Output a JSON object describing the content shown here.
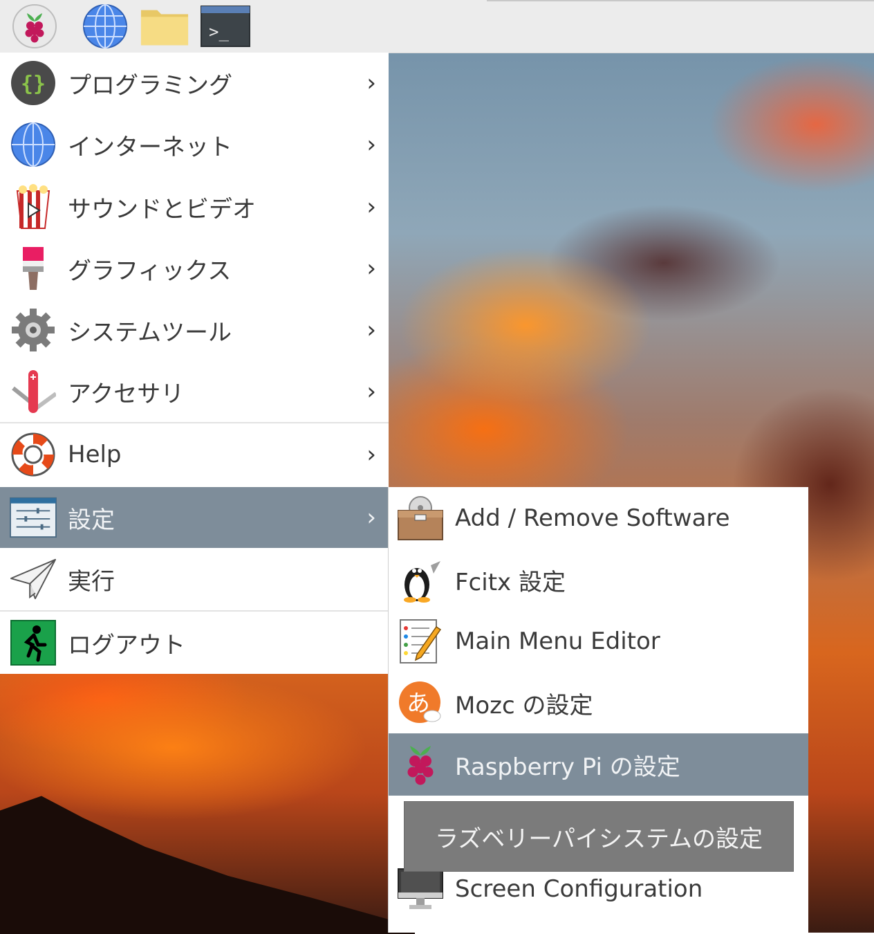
{
  "taskbar": {
    "buttons": [
      {
        "name": "raspberry-menu-button",
        "icon": "raspberry-icon"
      },
      {
        "name": "browser-button",
        "icon": "globe-icon"
      },
      {
        "name": "file-manager-button",
        "icon": "folder-icon"
      },
      {
        "name": "terminal-button",
        "icon": "terminal-icon"
      }
    ]
  },
  "main_menu": {
    "items": [
      {
        "label": "プログラミング",
        "icon": "programming-braces-icon",
        "has_submenu": true
      },
      {
        "label": "インターネット",
        "icon": "globe-icon",
        "has_submenu": true
      },
      {
        "label": "サウンドとビデオ",
        "icon": "popcorn-video-icon",
        "has_submenu": true
      },
      {
        "label": "グラフィックス",
        "icon": "paintbrush-icon",
        "has_submenu": true
      },
      {
        "label": "システムツール",
        "icon": "gear-icon",
        "has_submenu": true
      },
      {
        "label": "アクセサリ",
        "icon": "pocket-knife-icon",
        "has_submenu": true
      },
      {
        "label": "Help",
        "icon": "lifebuoy-icon",
        "has_submenu": true
      },
      {
        "label": "設定",
        "icon": "settings-sliders-icon",
        "has_submenu": true,
        "active": true
      },
      {
        "label": "実行",
        "icon": "paper-plane-icon",
        "has_submenu": false
      },
      {
        "label": "ログアウト",
        "icon": "exit-running-man-icon",
        "has_submenu": false
      }
    ],
    "arrow": "›"
  },
  "settings_submenu": {
    "items": [
      {
        "label": "Add / Remove Software",
        "icon": "package-box-icon"
      },
      {
        "label": "Fcitx 設定",
        "icon": "penguin-icon"
      },
      {
        "label": "Main Menu Editor",
        "icon": "menu-editor-pencil-icon"
      },
      {
        "label": "Mozc の設定",
        "icon": "mozc-a-icon"
      },
      {
        "label": "Raspberry Pi の設定",
        "icon": "raspberry-icon",
        "active": true
      },
      {
        "label": "Screen Configuration",
        "icon": "monitor-icon"
      }
    ]
  },
  "tooltip": {
    "text": "ラズベリーパイシステムの設定"
  },
  "colors": {
    "highlight": "#7e8d9a",
    "menu_bg": "#ffffff",
    "taskbar_bg": "#ececec",
    "tooltip_bg": "#7b7b7b"
  }
}
